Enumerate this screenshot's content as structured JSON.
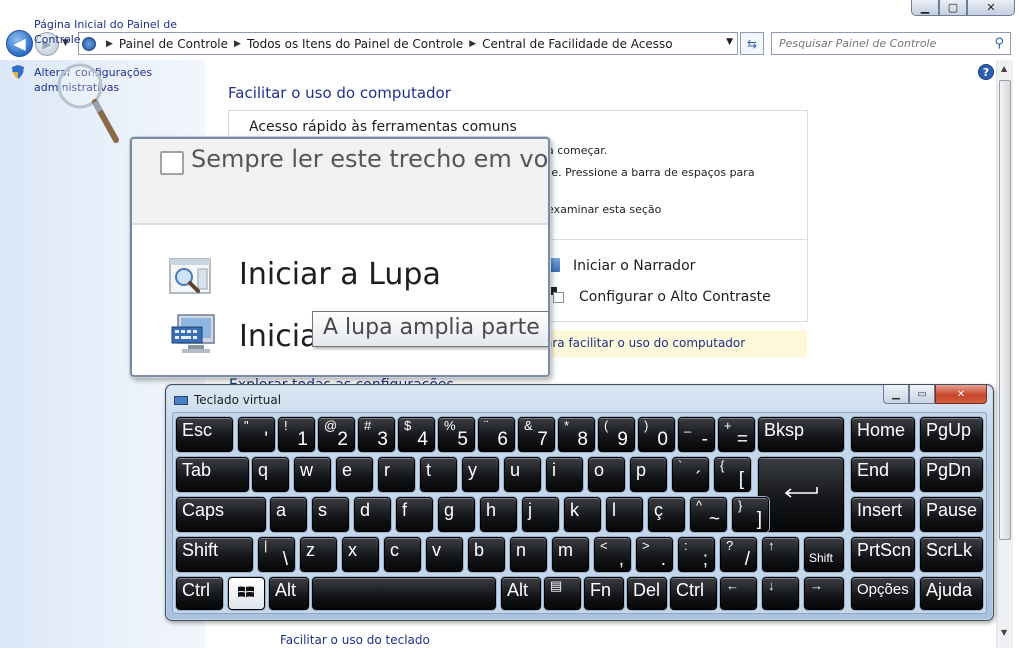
{
  "window": {
    "minimize": "▁",
    "maximize": "▢",
    "close": "✕"
  },
  "nav": {
    "back": "◀",
    "forward": "▶",
    "breadcrumbs": [
      "Painel de Controle",
      "Todos os Itens do Painel de Controle",
      "Central de Facilidade de Acesso"
    ],
    "search_placeholder": "Pesquisar Painel de Controle"
  },
  "sidebar": {
    "home_link": "Página Inicial do Painel de Controle",
    "admin_link": "Alterar configurações administrativas"
  },
  "content": {
    "title": "Facilitar o uso do computador",
    "quick_title": "Acesso rápido às ferramentas comuns",
    "bg_line1": "a começar.",
    "bg_line2": "te. Pressione a barra de espaços para",
    "bg_line3": "examinar esta seção",
    "narrator": "Iniciar o Narrador",
    "high_contrast": "Configurar o Alto Contraste",
    "info_link": "ara facilitar o uso do computador",
    "explore_link": "Explorar todas as configurações",
    "keyboard_link": "Facilitar o uso do teclado",
    "help": "?"
  },
  "lens": {
    "read_aloud": "Sempre ler este trecho em voz alta",
    "start_magnifier": "Iniciar a Lupa",
    "start_keyboard": "Iniciar o Teclado Virtual",
    "tooltip": "A lupa amplia parte da tela"
  },
  "osk": {
    "title": "Teclado virtual",
    "min": "▁",
    "max": "▭",
    "close": "✕",
    "keys": {
      "esc": "Esc",
      "quote_top": "\"",
      "quote_main": "'",
      "n1_top": "!",
      "n1": "1",
      "n2_top": "@",
      "n2": "2",
      "n3_top": "#",
      "n3": "3",
      "n4_top": "$",
      "n4": "4",
      "n5_top": "%",
      "n5": "5",
      "n6_top": "¨",
      "n6": "6",
      "n7_top": "&",
      "n7": "7",
      "n8_top": "*",
      "n8": "8",
      "n9_top": "(",
      "n9": "9",
      "n0_top": ")",
      "n0": "0",
      "minus_top": "_",
      "minus": "-",
      "eq_top": "+",
      "eq": "=",
      "bksp": "Bksp",
      "home": "Home",
      "pgup": "PgUp",
      "tab": "Tab",
      "q": "q",
      "w": "w",
      "e": "e",
      "r": "r",
      "t": "t",
      "y": "y",
      "u": "u",
      "i": "i",
      "o": "o",
      "p": "p",
      "acute_top": "`",
      "acute": "´",
      "bracket_top": "{",
      "bracket": "[",
      "end": "End",
      "pgdn": "PgDn",
      "caps": "Caps",
      "a": "a",
      "s": "s",
      "d": "d",
      "f": "f",
      "g": "g",
      "h": "h",
      "j": "j",
      "k": "k",
      "l": "l",
      "cedil": "ç",
      "tilde_top": "^",
      "tilde": "~",
      "rbracket_top": "}",
      "rbracket": "]",
      "insert": "Insert",
      "pause": "Pause",
      "shift": "Shift",
      "bslash_top": "|",
      "bslash": "\\",
      "z": "z",
      "x": "x",
      "c": "c",
      "v": "v",
      "b": "b",
      "n": "n",
      "m": "m",
      "comma_top": "<",
      "comma": ",",
      "period_top": ">",
      "period": ".",
      "semi_top": ":",
      "semi": ";",
      "slash_top": "?",
      "slash": "/",
      "up": "↑",
      "shift_r": "Shift",
      "prtscn": "PrtScn",
      "scrlk": "ScrLk",
      "ctrl": "Ctrl",
      "alt": "Alt",
      "altgr": "Alt",
      "menu": "▤",
      "fn": "Fn",
      "del": "Del",
      "ctrl_r": "Ctrl",
      "left": "←",
      "down": "↓",
      "right": "→",
      "options": "Opções",
      "help": "Ajuda"
    }
  }
}
